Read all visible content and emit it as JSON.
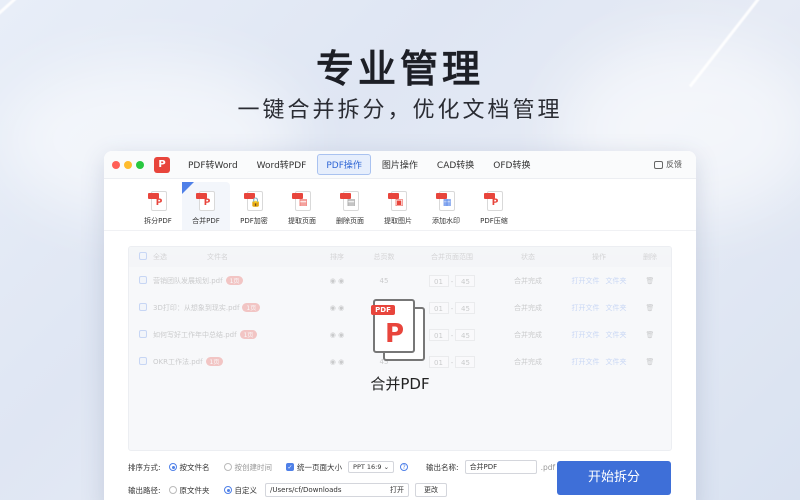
{
  "hero": {
    "title": "专业管理",
    "subtitle": "一键合并拆分，优化文档管理"
  },
  "app": {
    "logo": "P",
    "tabs": [
      {
        "label": "PDF转Word"
      },
      {
        "label": "Word转PDF"
      },
      {
        "label": "PDF操作",
        "active": true
      },
      {
        "label": "图片操作"
      },
      {
        "label": "CAD转换"
      },
      {
        "label": "OFD转换"
      }
    ],
    "feedback": "反馈"
  },
  "tools": [
    {
      "label": "拆分PDF",
      "icon": "split-pdf-icon"
    },
    {
      "label": "合并PDF",
      "icon": "merge-pdf-icon",
      "active": true
    },
    {
      "label": "PDF加密",
      "icon": "encrypt-pdf-icon"
    },
    {
      "label": "提取页面",
      "icon": "extract-pages-icon"
    },
    {
      "label": "删除页面",
      "icon": "delete-pages-icon"
    },
    {
      "label": "提取图片",
      "icon": "extract-images-icon"
    },
    {
      "label": "添加水印",
      "icon": "watermark-icon"
    },
    {
      "label": "PDF压缩",
      "icon": "compress-pdf-icon"
    }
  ],
  "table": {
    "headers": {
      "all": "全选",
      "name": "文件名",
      "op": "排序",
      "total": "总页数",
      "range": "合并页面范围",
      "status": "状态",
      "action": "操作",
      "del": "删除"
    },
    "rows": [
      {
        "name": "营销团队发展规划.pdf",
        "tag": "1页",
        "total": "45",
        "from": "01",
        "to": "45",
        "status": "合并完成",
        "open": "打开文件",
        "folder": "文件夹"
      },
      {
        "name": "3D打印：从想象到现实.pdf",
        "tag": "1页",
        "total": "45",
        "from": "01",
        "to": "45",
        "status": "合并完成",
        "open": "打开文件",
        "folder": "文件夹"
      },
      {
        "name": "如何写好工作年中总结.pdf",
        "tag": "1页",
        "total": "45",
        "from": "01",
        "to": "45",
        "status": "合并完成",
        "open": "打开文件",
        "folder": "文件夹"
      },
      {
        "name": "OKR工作法.pdf",
        "tag": "1页",
        "total": "45",
        "from": "01",
        "to": "45",
        "status": "合并完成",
        "open": "打开文件",
        "folder": "文件夹"
      }
    ]
  },
  "overlay": {
    "tag": "PDF",
    "label": "合并PDF"
  },
  "options": {
    "sort_label": "排序方式:",
    "sort_by_name": "按文件名",
    "sort_by_created": "按创建时间",
    "unify_size": "统一页面大小",
    "page_size": "PPT 16:9",
    "output_name_label": "输出名称:",
    "output_name": "合并PDF",
    "output_ext": ".pdf",
    "output_path_label": "输出路径:",
    "path_original": "原文件夹",
    "path_custom": "自定义",
    "path_value": "/Users/cf/Downloads",
    "open_label": "打开",
    "change_label": "更改",
    "start_label": "开始拆分"
  }
}
